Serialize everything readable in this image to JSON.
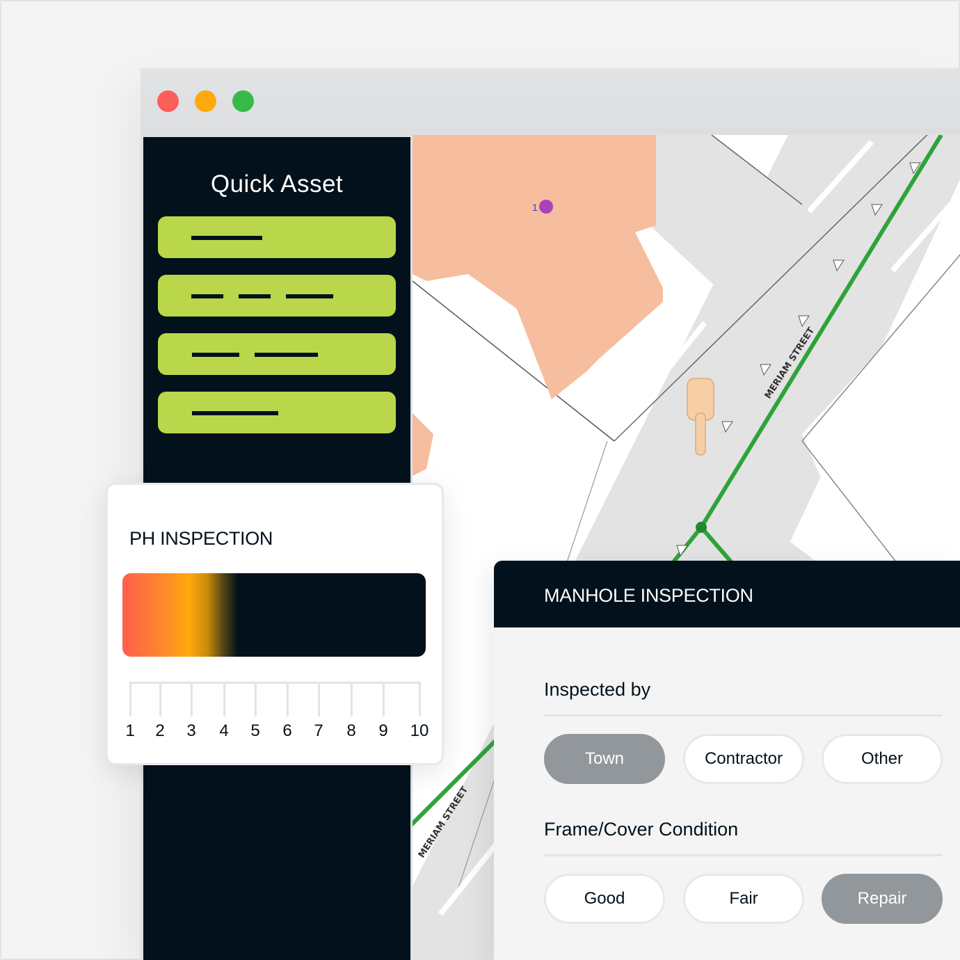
{
  "window": {
    "controls": [
      "close",
      "minimize",
      "maximize"
    ],
    "colors": {
      "close": "#fe5e5a",
      "minimize": "#ffa90c",
      "maximize": "#36bb4b"
    }
  },
  "sidebar": {
    "title": "Quick Asset",
    "items": [
      {
        "name": "quick-asset-item-1",
        "placeholder_lines": 1
      },
      {
        "name": "quick-asset-item-2",
        "placeholder_lines": 3
      },
      {
        "name": "quick-asset-item-3",
        "placeholder_lines": 2
      },
      {
        "name": "quick-asset-item-4",
        "placeholder_lines": 1
      }
    ],
    "accent_color": "#bad64a",
    "background_color": "#02111b"
  },
  "map": {
    "street_labels": [
      "MERIAM STREET",
      "MERIAM STREET"
    ],
    "marker_label": "1",
    "line_color": "#2ea33a",
    "building_color": "#f6bd9f"
  },
  "ph_inspection": {
    "title": "PH INSPECTION",
    "scale": [
      "1",
      "2",
      "3",
      "4",
      "5",
      "6",
      "7",
      "8",
      "9",
      "10"
    ],
    "level": 3.5,
    "gradient_colors": [
      "#fe5e4c",
      "#ffa90c",
      "#02111b"
    ]
  },
  "manhole_inspection": {
    "title": "MANHOLE INSPECTION",
    "inspected_by": {
      "label": "Inspected by",
      "options": [
        "Town",
        "Contractor",
        "Other"
      ],
      "selected": "Town"
    },
    "frame_cover_condition": {
      "label": "Frame/Cover Condition",
      "options": [
        "Good",
        "Fair",
        "Repair"
      ],
      "selected": "Repair"
    }
  }
}
